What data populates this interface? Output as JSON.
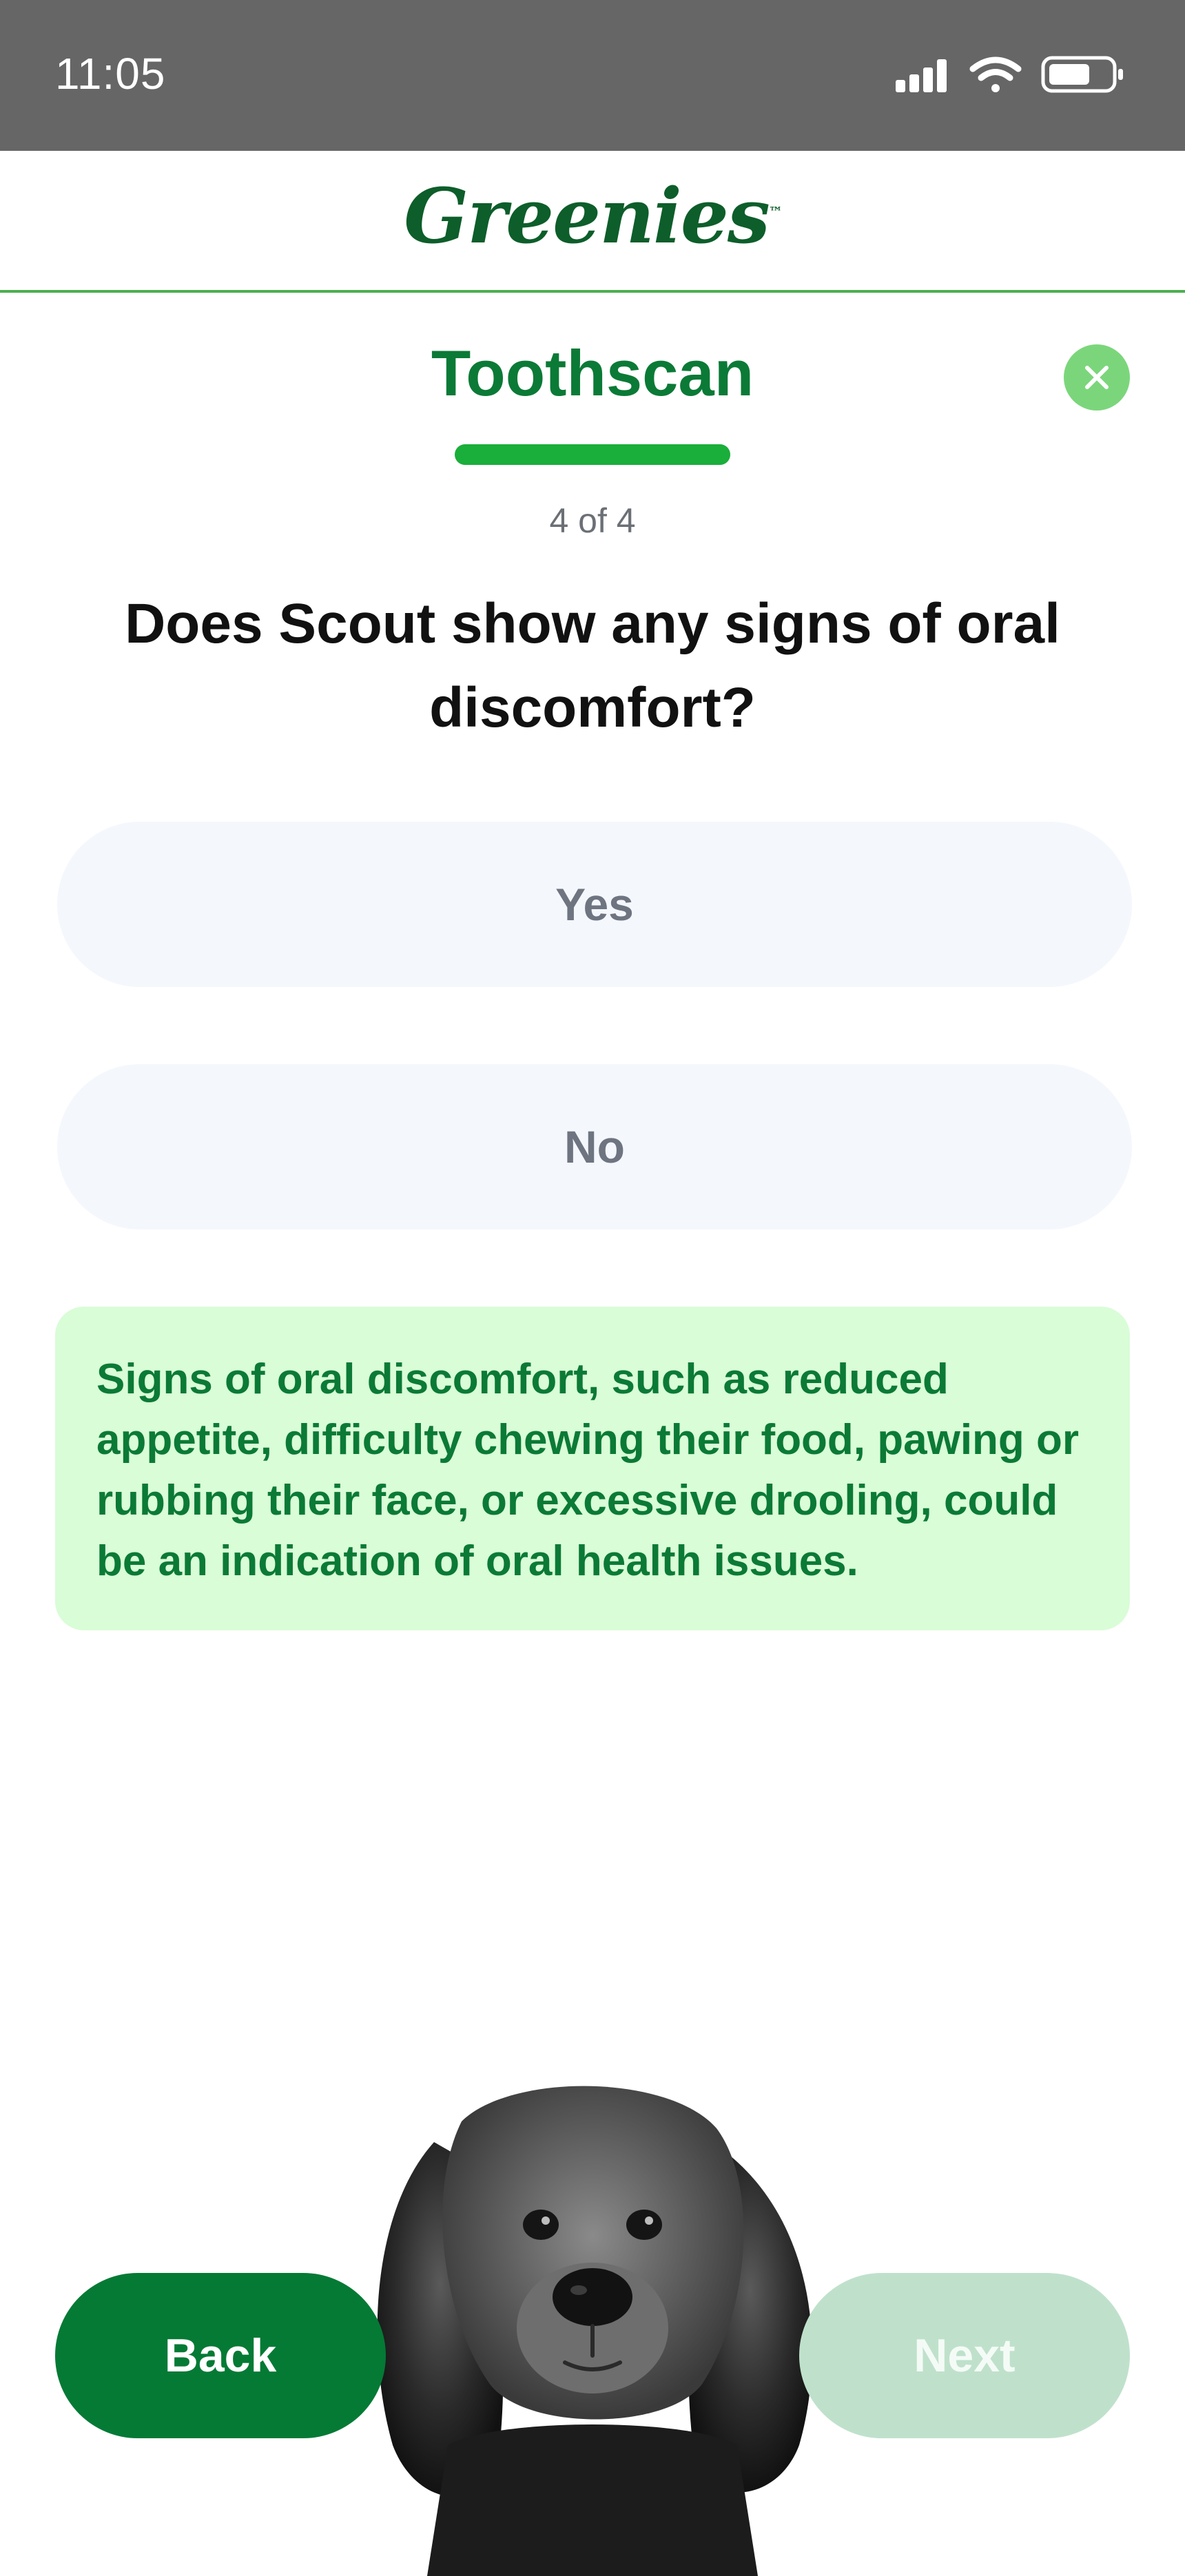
{
  "status_bar": {
    "time": "11:05"
  },
  "header": {
    "logo_text": "Greenies"
  },
  "flow": {
    "title": "Toothscan",
    "step_counter": "4 of 4",
    "progress": 1.0
  },
  "question": {
    "text": "Does Scout show any signs of oral discomfort?",
    "options": [
      {
        "label": "Yes"
      },
      {
        "label": "No"
      }
    ]
  },
  "info": {
    "text": "Signs of oral discomfort, such as reduced appetite, difficulty chewing their food, pawing or rubbing their face, or excessive drooling, could be an indication of oral health issues."
  },
  "nav": {
    "back_label": "Back",
    "next_label": "Next"
  },
  "colors": {
    "brand_green": "#0b7a36",
    "progress_green": "#1aae3a",
    "info_background": "#d9fdd7",
    "next_disabled": "#bfe1cb"
  },
  "icons": {
    "close": "close-icon",
    "signal": "signal-icon",
    "wifi": "wifi-icon",
    "battery": "battery-icon"
  }
}
